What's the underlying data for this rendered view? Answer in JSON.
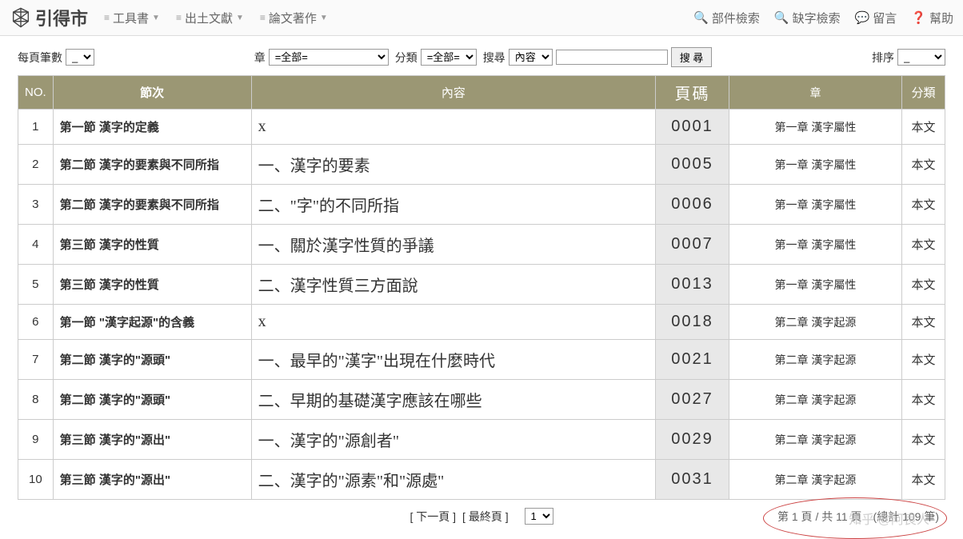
{
  "logo_text": "引得市",
  "nav": {
    "menu": [
      {
        "label": "工具書"
      },
      {
        "label": "出土文獻"
      },
      {
        "label": "論文著作"
      }
    ],
    "right": [
      {
        "label": "部件檢索",
        "icon": "search"
      },
      {
        "label": "缺字檢索",
        "icon": "search"
      },
      {
        "label": "留言",
        "icon": "comment"
      },
      {
        "label": "幫助",
        "icon": "help"
      }
    ]
  },
  "filter": {
    "per_page_label": "每頁筆數",
    "per_page_value": "_",
    "chapter_label": "章",
    "chapter_value": "=全部=",
    "category_label": "分類",
    "category_value": "=全部=",
    "search_label": "搜尋",
    "search_field_value": "內容",
    "search_input_value": "",
    "search_button": "搜 尋",
    "sort_label": "排序",
    "sort_value": "_"
  },
  "table": {
    "headers": {
      "no": "NO.",
      "section": "節次",
      "content": "內容",
      "page": "頁碼",
      "chapter": "章",
      "category": "分類"
    },
    "rows": [
      {
        "no": "1",
        "section": "第一節 漢字的定義",
        "content": "x",
        "page": "0001",
        "chapter": "第一章 漢字屬性",
        "category": "本文"
      },
      {
        "no": "2",
        "section": "第二節 漢字的要素與不同所指",
        "content": "一、漢字的要素",
        "page": "0005",
        "chapter": "第一章 漢字屬性",
        "category": "本文"
      },
      {
        "no": "3",
        "section": "第二節 漢字的要素與不同所指",
        "content": "二、\"字\"的不同所指",
        "page": "0006",
        "chapter": "第一章 漢字屬性",
        "category": "本文"
      },
      {
        "no": "4",
        "section": "第三節 漢字的性質",
        "content": "一、關於漢字性質的爭議",
        "page": "0007",
        "chapter": "第一章 漢字屬性",
        "category": "本文"
      },
      {
        "no": "5",
        "section": "第三節 漢字的性質",
        "content": "二、漢字性質三方面說",
        "page": "0013",
        "chapter": "第一章 漢字屬性",
        "category": "本文"
      },
      {
        "no": "6",
        "section": "第一節 \"漢字起源\"的含義",
        "content": "x",
        "page": "0018",
        "chapter": "第二章 漢字起源",
        "category": "本文"
      },
      {
        "no": "7",
        "section": "第二節 漢字的\"源頭\"",
        "content": "一、最早的\"漢字\"出現在什麼時代",
        "page": "0021",
        "chapter": "第二章 漢字起源",
        "category": "本文"
      },
      {
        "no": "8",
        "section": "第二節 漢字的\"源頭\"",
        "content": "二、早期的基礎漢字應該在哪些",
        "page": "0027",
        "chapter": "第二章 漢字起源",
        "category": "本文"
      },
      {
        "no": "9",
        "section": "第三節 漢字的\"源出\"",
        "content": "一、漢字的\"源創者\"",
        "page": "0029",
        "chapter": "第二章 漢字起源",
        "category": "本文"
      },
      {
        "no": "10",
        "section": "第三節 漢字的\"源出\"",
        "content": "二、漢字的\"源素\"和\"源處\"",
        "page": "0031",
        "chapter": "第二章 漢字起源",
        "category": "本文"
      }
    ]
  },
  "pager": {
    "next": "[ 下一頁 ]",
    "last": "[ 最終頁 ]",
    "page_select": "1",
    "info": "第 1 頁 / 共 11 頁　(總計 109 筆)"
  },
  "watermark": "知乎 @阿良人"
}
